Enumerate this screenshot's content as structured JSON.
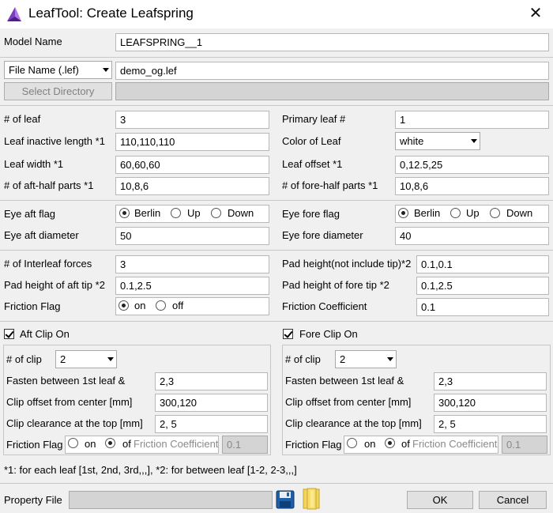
{
  "window": {
    "title": "LeafTool: Create Leafspring",
    "close": "✕"
  },
  "model": {
    "label": "Model Name",
    "value": "LEAFSPRING__1"
  },
  "file": {
    "type_option": "File Name (.lef)",
    "value": "demo_og.lef",
    "select_dir_label": "Select Directory",
    "dir_value": ""
  },
  "leaf": {
    "num_leaf_label": "# of leaf",
    "num_leaf": "3",
    "primary_label": "Primary leaf #",
    "primary": "1",
    "inactive_label": "Leaf inactive length *1",
    "inactive": "110,110,110",
    "color_label": "Color of Leaf",
    "color": "white",
    "width_label": "Leaf width *1",
    "width": "60,60,60",
    "offset_label": "Leaf offset *1",
    "offset": "0,12.5,25",
    "aft_parts_label": "# of aft-half parts *1",
    "aft_parts": "10,8,6",
    "fore_parts_label": "# of fore-half parts *1",
    "fore_parts": "10,8,6"
  },
  "eye": {
    "aft_flag_label": "Eye aft flag",
    "fore_flag_label": "Eye fore flag",
    "opt_berlin": "Berlin",
    "opt_up": "Up",
    "opt_down": "Down",
    "aft_diam_label": "Eye aft diameter",
    "aft_diam": "50",
    "fore_diam_label": "Eye fore diameter",
    "fore_diam": "40"
  },
  "interleaf": {
    "forces_label": "# of Interleaf forces",
    "forces": "3",
    "pad_height_label": "Pad height(not include tip)*2",
    "pad_height": "0.1,0.1",
    "aft_tip_label": "Pad height of aft tip *2",
    "aft_tip": "0.1,2.5",
    "fore_tip_label": "Pad height of fore tip *2",
    "fore_tip": "0.1,2.5",
    "friction_flag_label": "Friction Flag",
    "opt_on": "on",
    "opt_off": "off",
    "friction_coef_label": "Friction Coefficient",
    "friction_coef": "0.1"
  },
  "aft_clip": {
    "label": "Aft Clip On",
    "num_clip_label": "# of clip",
    "num_clip": "2",
    "fasten_label": "Fasten between 1st leaf &",
    "fasten": "2,3",
    "offset_label": "Clip offset from center [mm]",
    "offset": "300,120",
    "clearance_label": "Clip clearance at the top [mm]",
    "clearance": "2, 5",
    "friction_label": "Friction Flag",
    "opt_on": "on",
    "opt_off": "of",
    "coef_label": "Friction Coefficient",
    "coef": "0.1"
  },
  "fore_clip": {
    "label": "Fore Clip On",
    "num_clip_label": "# of clip",
    "num_clip": "2",
    "fasten_label": "Fasten between 1st leaf &",
    "fasten": "2,3",
    "offset_label": "Clip offset from center [mm]",
    "offset": "300,120",
    "clearance_label": "Clip clearance at the top [mm]",
    "clearance": "2, 5",
    "friction_label": "Friction Flag",
    "opt_on": "on",
    "opt_off": "of",
    "coef_label": "Friction Coefficient",
    "coef": "0.1"
  },
  "footnote": "*1: for each leaf [1st, 2nd, 3rd,,,], *2: for between leaf [1-2, 2-3,,,]",
  "property": {
    "label": "Property File",
    "value": ""
  },
  "buttons": {
    "ok": "OK",
    "cancel": "Cancel"
  }
}
